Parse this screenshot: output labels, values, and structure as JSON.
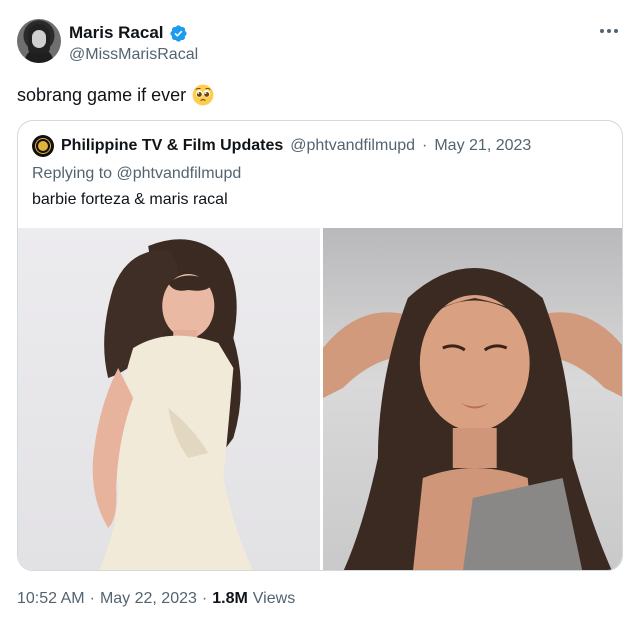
{
  "author": {
    "display_name": "Maris Racal",
    "handle": "@MissMarisRacal",
    "verified": true
  },
  "tweet": {
    "text": "sobrang game if ever",
    "emoji": "pleading-face-emoji"
  },
  "quoted_tweet": {
    "display_name": "Philippine TV & Film Updates",
    "handle": "@phtvandfilmupd",
    "separator": "·",
    "date": "May 21, 2023",
    "replying_to": "Replying to @phtvandfilmupd",
    "text": "barbie forteza & maris racal",
    "media": [
      {
        "description_icon": "photo-barbie-forteza"
      },
      {
        "description_icon": "photo-maris-racal"
      }
    ]
  },
  "footer": {
    "time": "10:52 AM",
    "separator": "·",
    "date": "May 22, 2023",
    "separator2": "·",
    "views_count": "1.8M",
    "views_label": "Views"
  },
  "colors": {
    "text_primary": "#0f1419",
    "text_secondary": "#536471",
    "verified_blue": "#1d9bf0",
    "border": "#cfd9de"
  }
}
